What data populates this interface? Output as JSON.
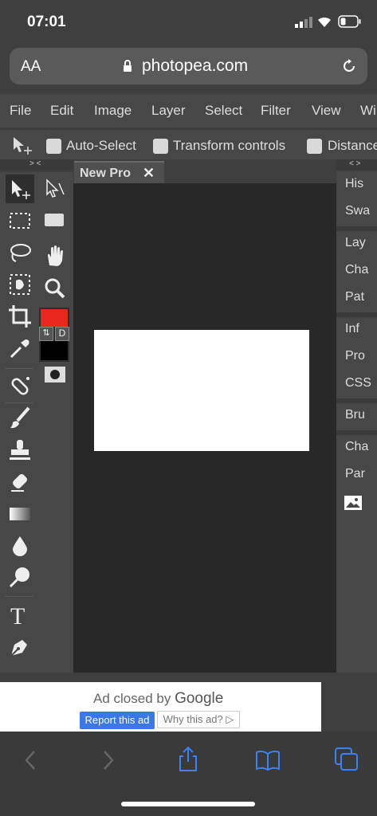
{
  "status": {
    "time": "07:01"
  },
  "browser": {
    "aa_label": "AA",
    "url": "photopea.com"
  },
  "menu": [
    "File",
    "Edit",
    "Image",
    "Layer",
    "Select",
    "Filter",
    "View",
    "Wi"
  ],
  "options": {
    "auto_select": "Auto-Select",
    "transform_controls": "Transform controls",
    "distances": "Distance"
  },
  "ruler": {
    "left": "> <",
    "right": "< >"
  },
  "tab": {
    "title": "New Pro",
    "close": "✕"
  },
  "colors": {
    "foreground": "#e8281d",
    "background": "#000000",
    "swap_label": "⇅",
    "default_label": "D"
  },
  "right_panels": [
    "His",
    "Swa",
    "Lay",
    "Cha",
    "Pat",
    "Inf",
    "Pro",
    "CSS",
    "Bru",
    "Cha",
    "Par"
  ],
  "ad": {
    "closed_prefix": "Ad closed by",
    "closed_brand": "Google",
    "report": "Report this ad",
    "why": "Why this ad? ▷"
  },
  "icons": [
    "move-icon",
    "marquee-icon",
    "lasso-icon",
    "quick-select-icon",
    "crop-icon",
    "eyedropper-icon",
    "healing-icon",
    "brush-icon",
    "stamp-icon",
    "eraser-icon",
    "gradient-icon",
    "blur-icon",
    "dodge-icon",
    "type-icon",
    "pen-icon",
    "path-select-icon",
    "shape-icon",
    "hand-icon",
    "zoom-icon",
    "quick-mask-icon",
    "image-icon"
  ]
}
